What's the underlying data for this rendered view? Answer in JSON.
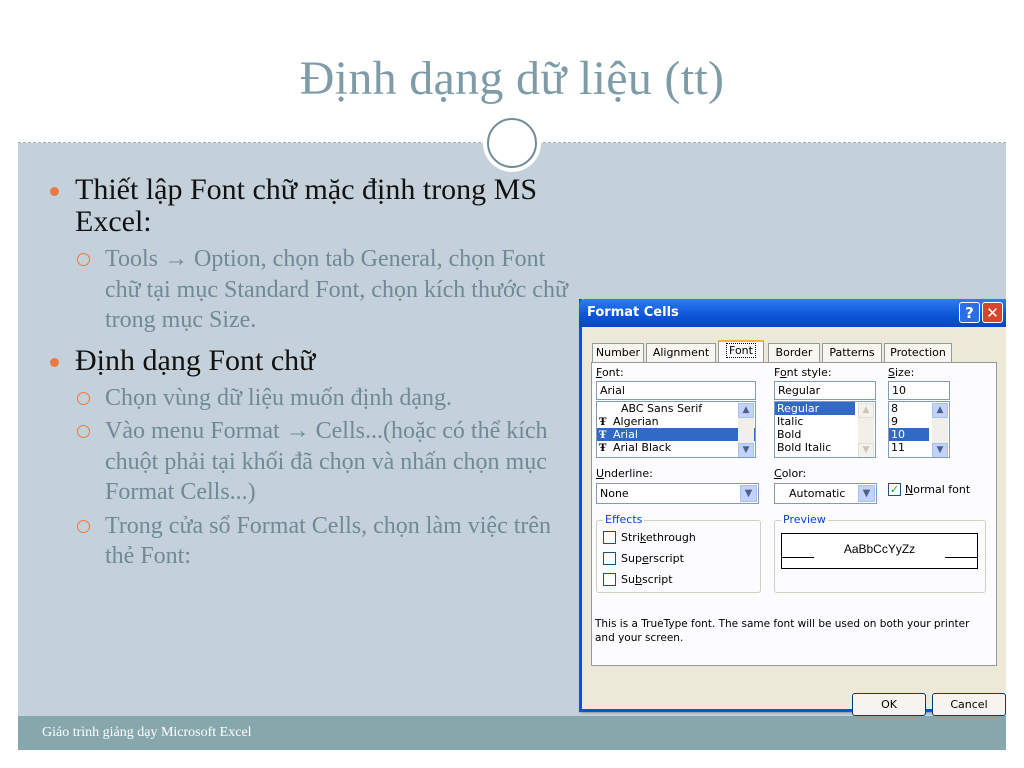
{
  "slide": {
    "title": "Định dạng dữ liệu (tt)",
    "footer": "Giáo trình giảng dạy Microsoft Excel",
    "bullets": [
      {
        "text": "Thiết lập Font chữ mặc định trong MS Excel:",
        "sub": [
          "Tools → Option, chọn tab General, chọn Font chữ tại mục Standard Font, chọn kích thước chữ trong mục Size."
        ]
      },
      {
        "text": "Định dạng Font chữ",
        "sub": [
          "Chọn vùng dữ liệu muốn định dạng.",
          "Vào menu Format → Cells...(hoặc có thể kích chuột phải tại khối đã chọn và nhấn chọn mục Format Cells...)",
          "Trong cửa sổ Format Cells, chọn làm việc trên thẻ Font:"
        ]
      }
    ]
  },
  "dialog": {
    "title": "Format Cells",
    "help_glyph": "?",
    "close_glyph": "✕",
    "tabs": [
      "Number",
      "Alignment",
      "Font",
      "Border",
      "Patterns",
      "Protection"
    ],
    "active_tab": "Font",
    "font": {
      "label_prefix": "F",
      "label_rest": "ont:",
      "value": "Arial",
      "items": [
        "ABC Sans Serif",
        "Algerian",
        "Arial",
        "Arial Black"
      ],
      "selected": "Arial"
    },
    "font_style": {
      "label_a": "F",
      "label_b": "o",
      "label_c": "nt style:",
      "value": "Regular",
      "items": [
        "Regular",
        "Italic",
        "Bold",
        "Bold Italic"
      ],
      "selected": "Regular"
    },
    "size": {
      "label_prefix": "S",
      "label_rest": "ize:",
      "value": "10",
      "items": [
        "8",
        "9",
        "10",
        "11"
      ],
      "selected": "10"
    },
    "underline": {
      "label_prefix": "U",
      "label_rest": "nderline:",
      "value": "None"
    },
    "color": {
      "label_prefix": "C",
      "label_rest": "olor:",
      "value": "Automatic"
    },
    "normal_font": {
      "label_prefix": "N",
      "label_rest": "ormal font",
      "checked": true
    },
    "effects": {
      "title": "Effects",
      "strikethrough_a": "Stri",
      "strikethrough_b": "k",
      "strikethrough_c": "ethrough",
      "superscript_a": "Sup",
      "superscript_b": "e",
      "superscript_c": "rscript",
      "subscript_a": "Su",
      "subscript_b": "b",
      "subscript_c": "script"
    },
    "preview": {
      "title": "Preview",
      "sample": "AaBbCcYyZz"
    },
    "info": "This is a TrueType font.  The same font will be used on both your printer and your screen.",
    "ok_label": "OK",
    "cancel_label": "Cancel"
  },
  "colors": {
    "slide_bg": "#c5d1da",
    "title": "#7d9ca8",
    "bullet_accent": "#e77a46",
    "sub_text": "#6f8a96",
    "footer_bar": "#86a8ad",
    "titlebar_blue": "#0a55d6",
    "selection": "#316ac5"
  }
}
